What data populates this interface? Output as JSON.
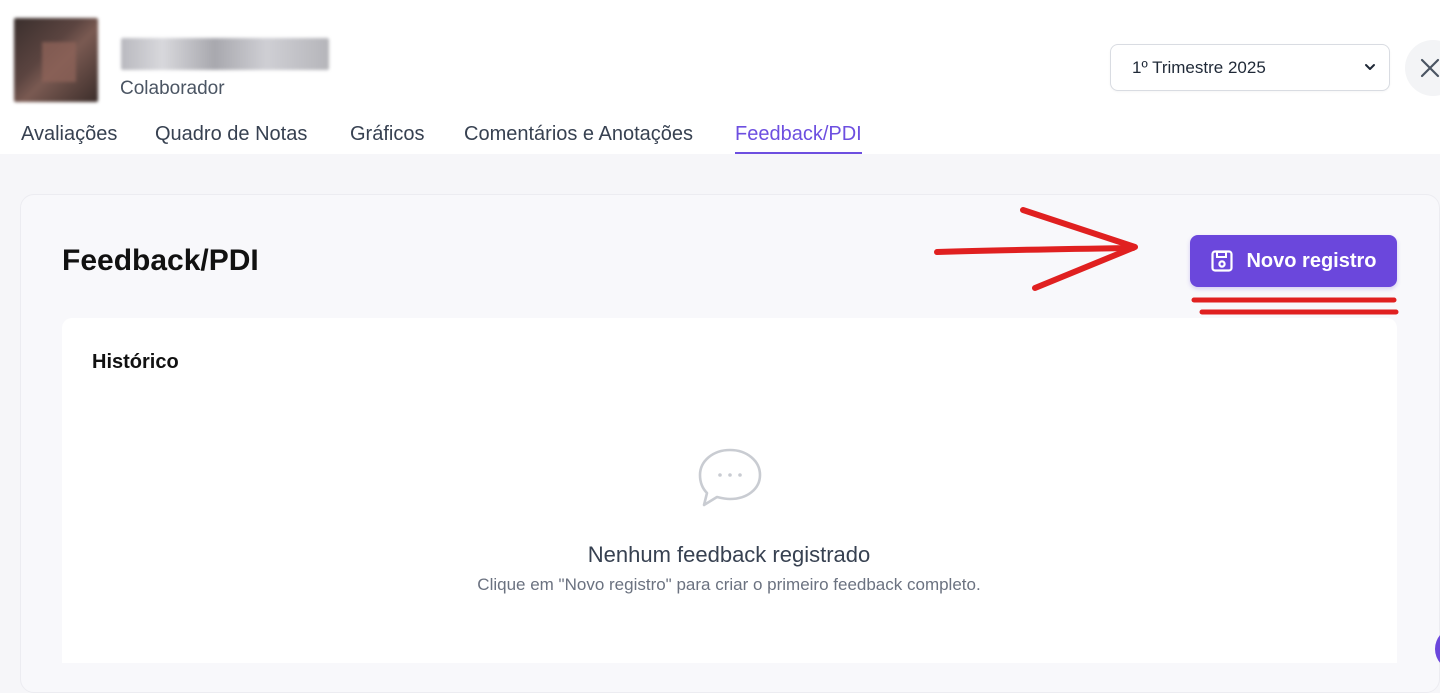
{
  "header": {
    "role": "Colaborador",
    "period_select": {
      "value": "1º Trimestre 2025"
    }
  },
  "tabs": [
    {
      "label": "Avaliações",
      "active": false
    },
    {
      "label": "Quadro de Notas",
      "active": false
    },
    {
      "label": "Gráficos",
      "active": false
    },
    {
      "label": "Comentários e Anotações",
      "active": false
    },
    {
      "label": "Feedback/PDI",
      "active": true
    }
  ],
  "main": {
    "title": "Feedback/PDI",
    "new_button_label": "Novo registro",
    "history": {
      "title": "Histórico",
      "empty_title": "Nenhum feedback registrado",
      "empty_subtitle": "Clique em \"Novo registro\" para criar o primeiro feedback completo."
    }
  },
  "colors": {
    "accent": "#6b47dc",
    "annotation": "#e02020"
  },
  "icons": {
    "close": "close-icon",
    "select": "chevron-down-icon",
    "save": "save-icon",
    "empty": "chat-bubble-icon"
  }
}
